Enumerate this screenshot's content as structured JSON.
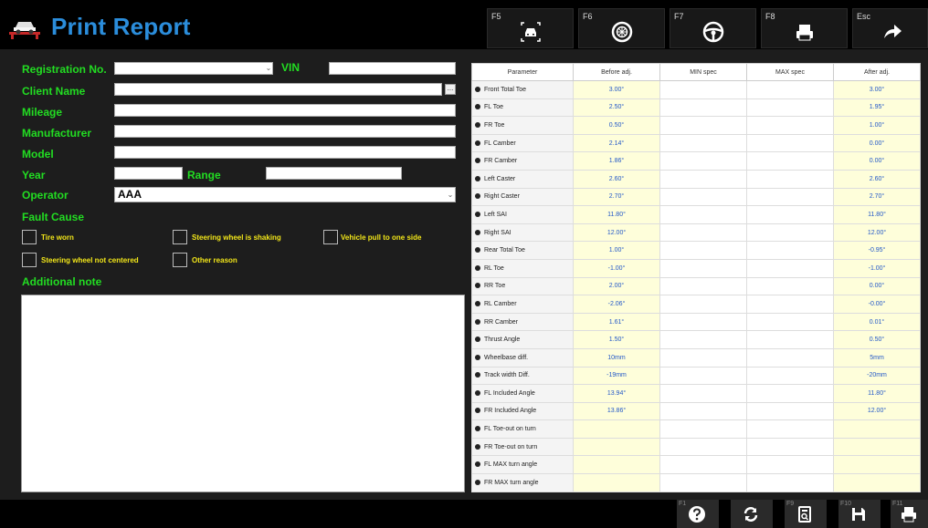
{
  "header": {
    "title": "Print Report",
    "fkeys": [
      {
        "key": "F5",
        "icon": "car-front-camera-icon"
      },
      {
        "key": "F6",
        "icon": "wheel-icon"
      },
      {
        "key": "F7",
        "icon": "steering-wheel-icon"
      },
      {
        "key": "F8",
        "icon": "printer-icon"
      },
      {
        "key": "Esc",
        "icon": "arrow-right-icon"
      }
    ]
  },
  "form": {
    "registration_label": "Registration No.",
    "vin_label": "VIN",
    "client_label": "Client Name",
    "mileage_label": "Mileage",
    "manufacturer_label": "Manufacturer",
    "model_label": "Model",
    "year_label": "Year",
    "range_label": "Range",
    "operator_label": "Operator",
    "operator_value": "AAA",
    "fault_label": "Fault Cause",
    "note_label": "Additional note",
    "faults": {
      "tire_worn": "Tire worn",
      "steering_shaking": "Steering wheel is shaking",
      "pull_side": "Vehicle pull to one side",
      "not_centered": "Steering wheel not centered",
      "other": "Other reason"
    }
  },
  "table": {
    "headers": [
      "Parameter",
      "Before adj.",
      "MIN spec",
      "MAX spec",
      "After adj."
    ],
    "rows": [
      {
        "name": "Front Total Toe",
        "before": "3.00°",
        "after": "3.00°"
      },
      {
        "name": "FL Toe",
        "before": "2.50°",
        "after": "1.95°"
      },
      {
        "name": "FR Toe",
        "before": "0.50°",
        "after": "1.00°"
      },
      {
        "name": "FL Camber",
        "before": "2.14°",
        "after": "0.00°"
      },
      {
        "name": "FR Camber",
        "before": "1.86°",
        "after": "0.00°"
      },
      {
        "name": "Left Caster",
        "before": "2.60°",
        "after": "2.60°"
      },
      {
        "name": "Right Caster",
        "before": "2.70°",
        "after": "2.70°"
      },
      {
        "name": "Left SAI",
        "before": "11.80°",
        "after": "11.80°"
      },
      {
        "name": "Right SAI",
        "before": "12.00°",
        "after": "12.00°"
      },
      {
        "name": "Rear Total Toe",
        "before": "1.00°",
        "after": "-0.95°"
      },
      {
        "name": "RL Toe",
        "before": "-1.00°",
        "after": "-1.00°"
      },
      {
        "name": "RR Toe",
        "before": "2.00°",
        "after": "0.00°"
      },
      {
        "name": "RL Camber",
        "before": "-2.06°",
        "after": "-0.00°"
      },
      {
        "name": "RR Camber",
        "before": "1.61°",
        "after": "0.01°"
      },
      {
        "name": "Thrust Angle",
        "before": "1.50°",
        "after": "0.50°"
      },
      {
        "name": "Wheelbase diff.",
        "before": "10mm",
        "after": "5mm"
      },
      {
        "name": "Track width Diff.",
        "before": "-19mm",
        "after": "-20mm"
      },
      {
        "name": "FL Included Angle",
        "before": "13.94°",
        "after": "11.80°"
      },
      {
        "name": "FR Included Angle",
        "before": "13.86°",
        "after": "12.00°"
      },
      {
        "name": "FL Toe-out on turn",
        "before": "",
        "after": ""
      },
      {
        "name": "FR Toe-out on turn",
        "before": "",
        "after": ""
      },
      {
        "name": "FL MAX turn angle",
        "before": "",
        "after": ""
      },
      {
        "name": "FR MAX turn angle",
        "before": "",
        "after": ""
      }
    ]
  },
  "footer": {
    "keys": [
      {
        "key": "F1",
        "icon": "help-icon"
      },
      {
        "key": "",
        "icon": "refresh-icon"
      },
      {
        "key": "F9",
        "icon": "print-preview-icon"
      },
      {
        "key": "F10",
        "icon": "save-icon"
      },
      {
        "key": "F11",
        "icon": "printer-icon"
      }
    ]
  },
  "colors": {
    "title": "#2b8ddb",
    "label": "#22dd22",
    "checkbox_label": "#f2e619",
    "value": "#2358c8",
    "value_bg": "#fefeda"
  }
}
